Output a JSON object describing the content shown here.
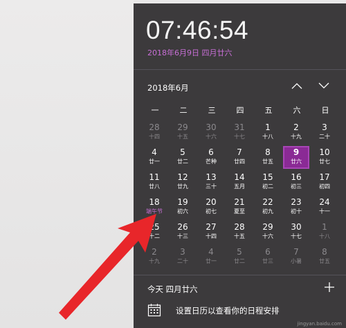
{
  "clock": {
    "time": "07:46:54",
    "date_long": "2018年6月9日 四月廿六"
  },
  "calendar": {
    "month_title": "2018年6月",
    "weekdays": [
      "一",
      "二",
      "三",
      "四",
      "五",
      "六",
      "日"
    ],
    "weeks": [
      [
        {
          "n": "28",
          "s": "十四",
          "dim": true
        },
        {
          "n": "29",
          "s": "十五",
          "dim": true
        },
        {
          "n": "30",
          "s": "十六",
          "dim": true
        },
        {
          "n": "31",
          "s": "十七",
          "dim": true
        },
        {
          "n": "1",
          "s": "十八"
        },
        {
          "n": "2",
          "s": "十九"
        },
        {
          "n": "3",
          "s": "二十"
        }
      ],
      [
        {
          "n": "4",
          "s": "廿一"
        },
        {
          "n": "5",
          "s": "廿二"
        },
        {
          "n": "6",
          "s": "芒种"
        },
        {
          "n": "7",
          "s": "廿四"
        },
        {
          "n": "8",
          "s": "廿五"
        },
        {
          "n": "9",
          "s": "廿六",
          "today": true
        },
        {
          "n": "10",
          "s": "廿七"
        }
      ],
      [
        {
          "n": "11",
          "s": "廿八"
        },
        {
          "n": "12",
          "s": "廿九"
        },
        {
          "n": "13",
          "s": "三十"
        },
        {
          "n": "14",
          "s": "五月"
        },
        {
          "n": "15",
          "s": "初二"
        },
        {
          "n": "16",
          "s": "初三"
        },
        {
          "n": "17",
          "s": "初四"
        }
      ],
      [
        {
          "n": "18",
          "s": "端午节",
          "holiday": true
        },
        {
          "n": "19",
          "s": "初六"
        },
        {
          "n": "20",
          "s": "初七"
        },
        {
          "n": "21",
          "s": "夏至"
        },
        {
          "n": "22",
          "s": "初九"
        },
        {
          "n": "23",
          "s": "初十"
        },
        {
          "n": "24",
          "s": "十一"
        }
      ],
      [
        {
          "n": "25",
          "s": "十二"
        },
        {
          "n": "26",
          "s": "十三"
        },
        {
          "n": "27",
          "s": "十四"
        },
        {
          "n": "28",
          "s": "十五"
        },
        {
          "n": "29",
          "s": "十六"
        },
        {
          "n": "30",
          "s": "十七"
        },
        {
          "n": "1",
          "s": "十八",
          "dim": true
        }
      ],
      [
        {
          "n": "2",
          "s": "十九",
          "dim": true
        },
        {
          "n": "3",
          "s": "二十",
          "dim": true
        },
        {
          "n": "4",
          "s": "廿一",
          "dim": true
        },
        {
          "n": "5",
          "s": "廿二",
          "dim": true
        },
        {
          "n": "6",
          "s": "廿三",
          "dim": true
        },
        {
          "n": "7",
          "s": "小暑",
          "dim": true
        },
        {
          "n": "8",
          "s": "廿五",
          "dim": true
        }
      ]
    ]
  },
  "agenda": {
    "today_label": "今天 四月廿六",
    "hint": "设置日历以查看你的日程安排"
  },
  "watermark": "jingyan.baidu.com",
  "colors": {
    "panel_bg": "#3c3a3c",
    "accent": "#8a2a95",
    "accent_text": "#c86fd6",
    "arrow": "#e8262a"
  }
}
